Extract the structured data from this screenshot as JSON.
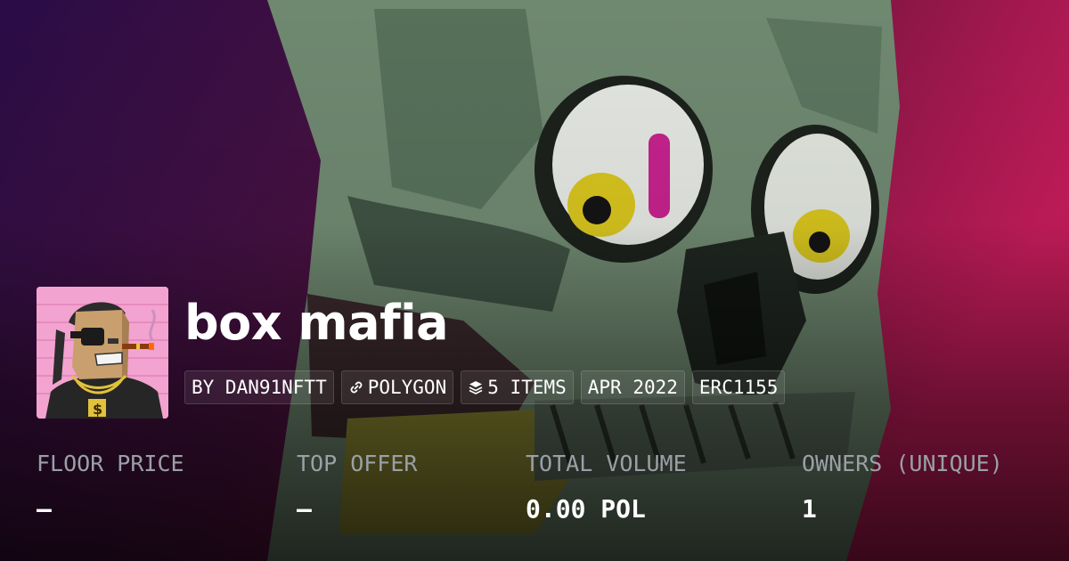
{
  "collection": {
    "name": "box mafia",
    "creator": "BY DAN91NFTT",
    "chain": "POLYGON",
    "items": "5 ITEMS",
    "date": "APR 2022",
    "standard": "ERC1155"
  },
  "icons": {
    "chain": "polygon-link-icon",
    "items": "layers-icon"
  },
  "stats": [
    {
      "label": "FLOOR PRICE",
      "value": "–"
    },
    {
      "label": "TOP OFFER",
      "value": "–"
    },
    {
      "label": "TOTAL VOLUME",
      "value": "0.00 POL"
    },
    {
      "label": "OWNERS (UNIQUE)",
      "value": "1"
    }
  ],
  "colors": {
    "text": "#ffffff",
    "label": "#9aa0a6",
    "avatar_bg": "#f3a3cf",
    "background_left": "#2a0c46",
    "background_right": "#c41c5a",
    "artwork_green": "#6f8870"
  }
}
